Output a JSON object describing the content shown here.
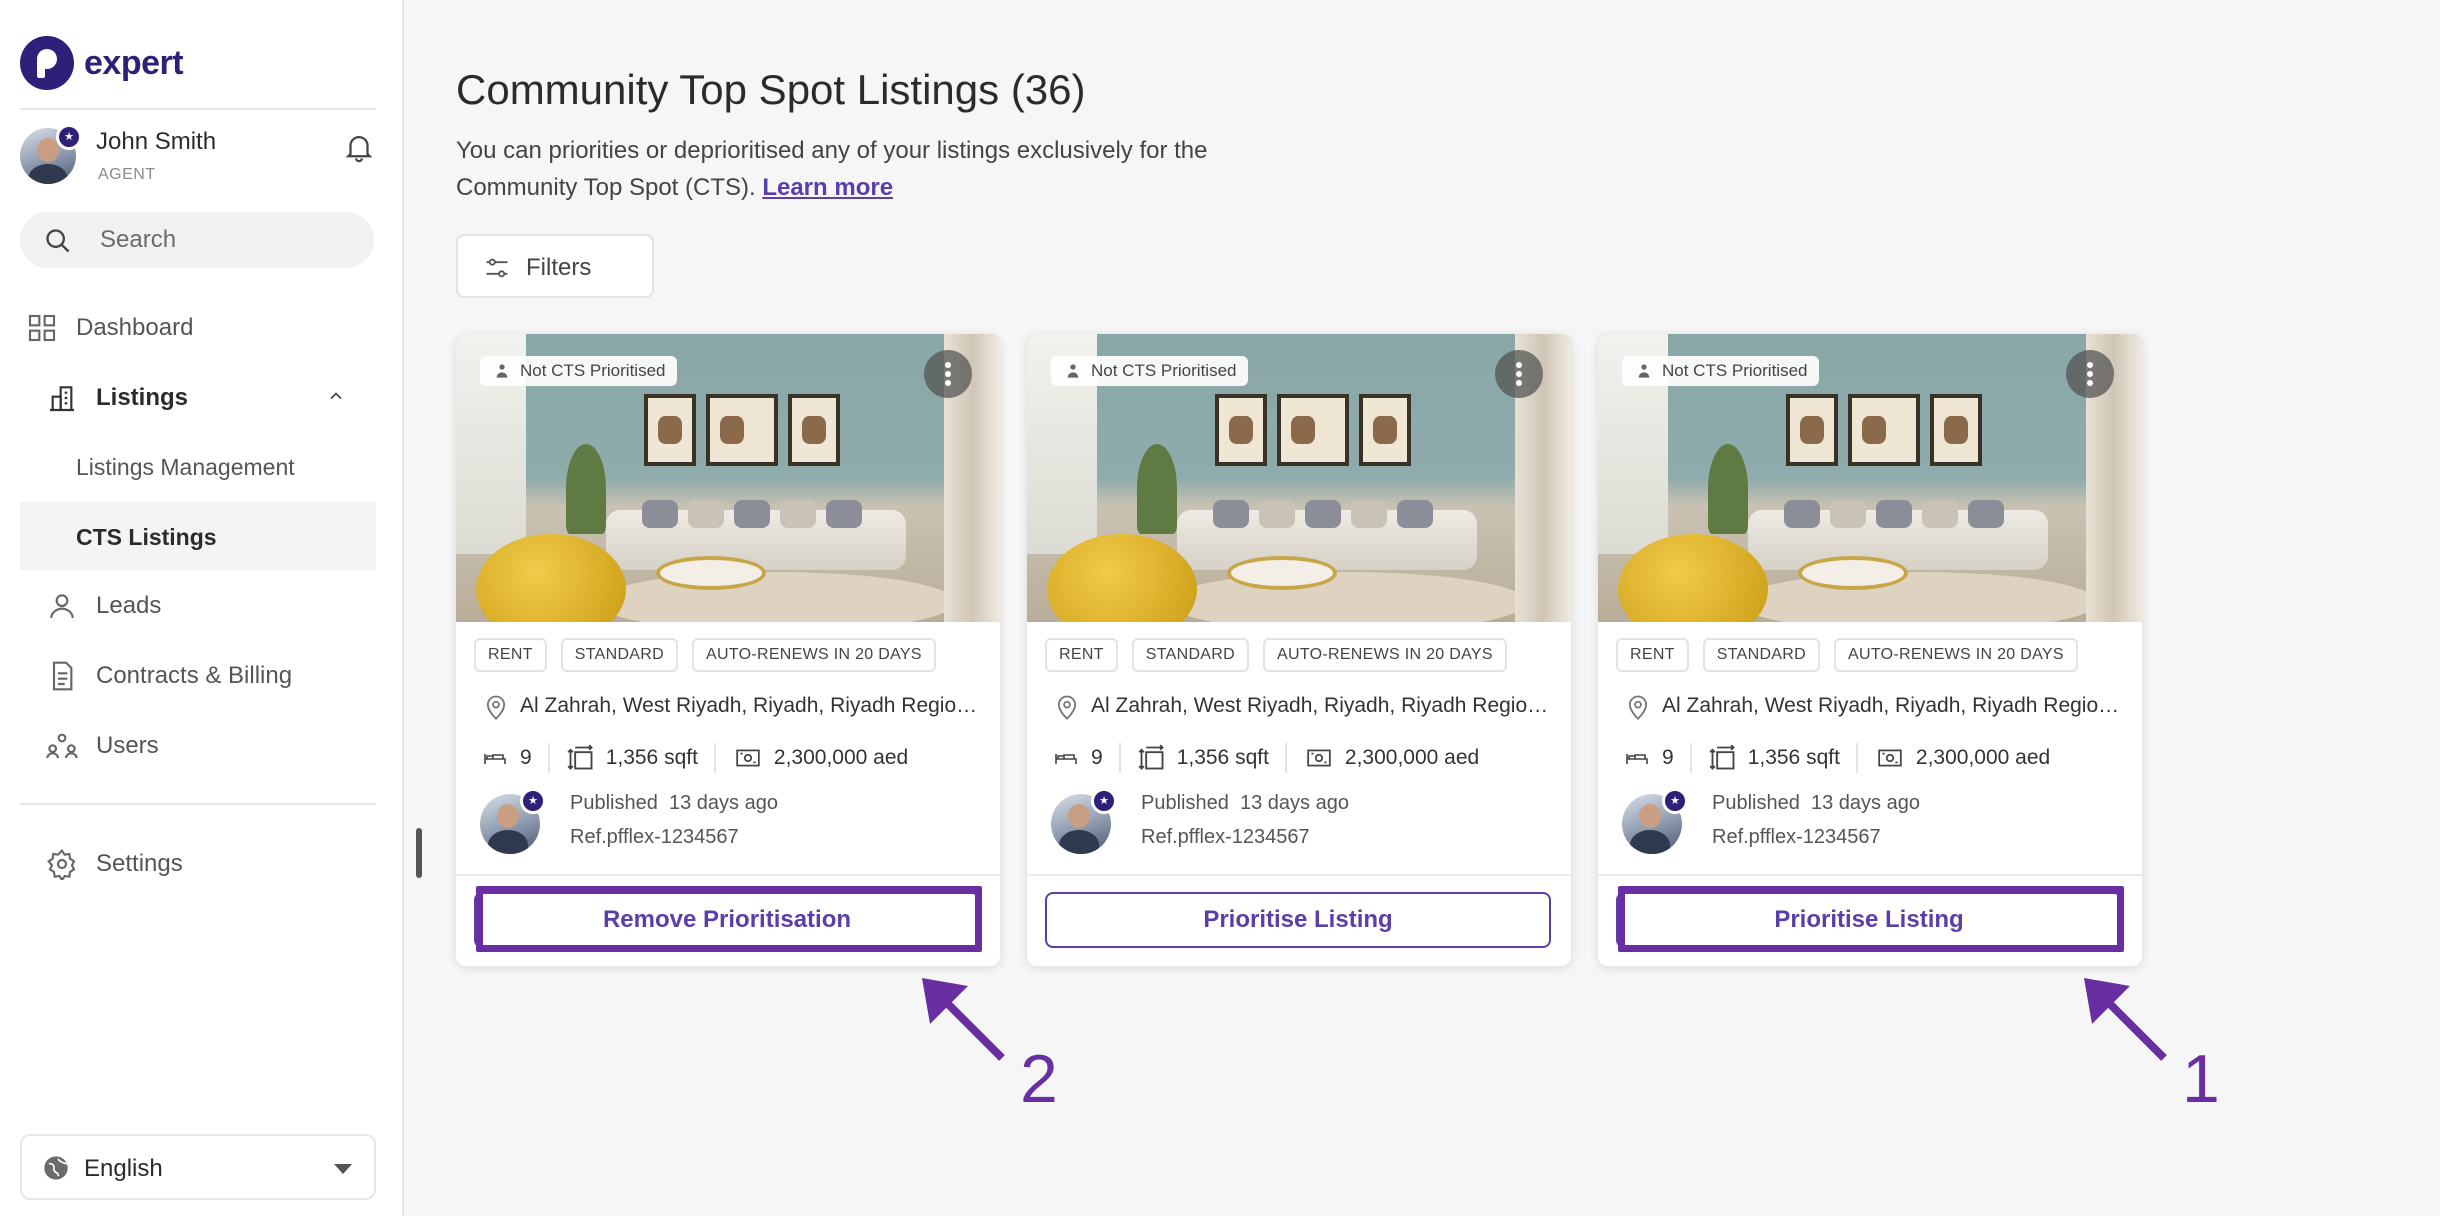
{
  "brand": {
    "logo_text": "expert",
    "primary_color": "#2e1f79",
    "accent_color": "#5b3ea8",
    "annotation_color": "#6a2ea3"
  },
  "user": {
    "name": "John Smith",
    "role": "AGENT"
  },
  "search": {
    "placeholder": "Search"
  },
  "nav": {
    "dashboard": "Dashboard",
    "listings": "Listings",
    "listings_management": "Listings Management",
    "cts_listings": "CTS Listings",
    "leads": "Leads",
    "contracts_billing": "Contracts & Billing",
    "users": "Users",
    "settings": "Settings"
  },
  "language": {
    "selected": "English"
  },
  "page": {
    "title": "Community Top Spot Listings (36)",
    "description": "You can priorities or deprioritised any of your listings exclusively for the Community Top Spot (CTS).",
    "learn_more": "Learn more",
    "filters_label": "Filters"
  },
  "cards": [
    {
      "cts_status": "Not CTS Prioritised",
      "tags": [
        "RENT",
        "STANDARD",
        "AUTO-RENEWS IN 20 DAYS"
      ],
      "location": "Al Zahrah, West Riyadh, Riyadh, Riyadh Region, Saudi Arabia",
      "bedrooms": "9",
      "area": "1,356 sqft",
      "price": "2,300,000 aed",
      "published_label": "Published",
      "published_ago": "13 days ago",
      "ref": "Ref.pfflex-1234567",
      "action": "Remove Prioritisation",
      "highlighted": true
    },
    {
      "cts_status": "Not CTS Prioritised",
      "tags": [
        "RENT",
        "STANDARD",
        "AUTO-RENEWS IN 20 DAYS"
      ],
      "location": "Al Zahrah, West Riyadh, Riyadh, Riyadh Region, Saudi Arabia",
      "bedrooms": "9",
      "area": "1,356 sqft",
      "price": "2,300,000 aed",
      "published_label": "Published",
      "published_ago": "13 days ago",
      "ref": "Ref.pfflex-1234567",
      "action": "Prioritise Listing",
      "highlighted": false
    },
    {
      "cts_status": "Not CTS Prioritised",
      "tags": [
        "RENT",
        "STANDARD",
        "AUTO-RENEWS IN 20 DAYS"
      ],
      "location": "Al Zahrah, West Riyadh, Riyadh, Riyadh Region, Saudi Arabia",
      "bedrooms": "9",
      "area": "1,356 sqft",
      "price": "2,300,000 aed",
      "published_label": "Published",
      "published_ago": "13 days ago",
      "ref": "Ref.pfflex-1234567",
      "action": "Prioritise Listing",
      "highlighted": true
    }
  ],
  "annotations": [
    {
      "label": "2",
      "target": "card-0-action"
    },
    {
      "label": "1",
      "target": "card-2-action"
    }
  ]
}
